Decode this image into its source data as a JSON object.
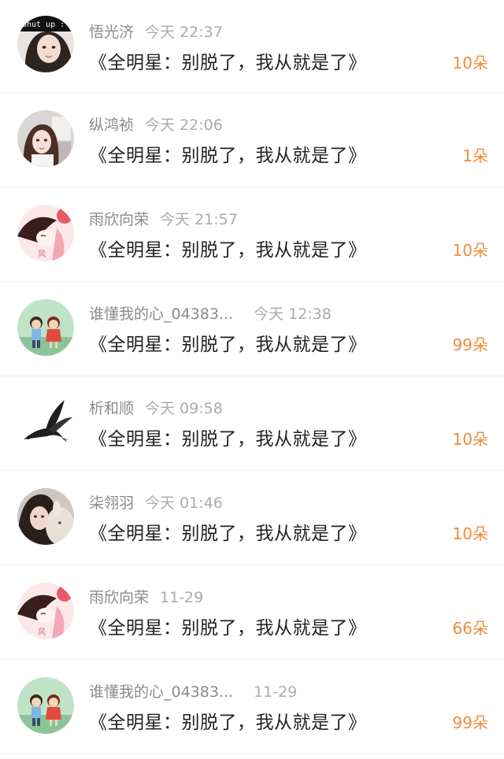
{
  "comments": [
    {
      "name": "悟光济",
      "time": "今天 22:37",
      "text": "《全明星：别脱了，我从就是了》",
      "gift": "10朵",
      "avatar": {
        "icon": "avatar-girl-photo-icon",
        "overlay": "Shut up :"
      }
    },
    {
      "name": "纵鸿祯",
      "time": "今天 22:06",
      "text": "《全明星：别脱了，我从就是了》",
      "gift": "1朵",
      "avatar": {
        "icon": "avatar-girl-room-icon"
      }
    },
    {
      "name": "雨欣向荣",
      "time": "今天 21:57",
      "text": "《全明星：别脱了，我从就是了》",
      "gift": "10朵",
      "avatar": {
        "icon": "avatar-anime-girl-icon"
      }
    },
    {
      "name": "谁懂我的心_04383...",
      "time": "今天 12:38",
      "text": "《全明星：别脱了，我从就是了》",
      "gift": "99朵",
      "avatar": {
        "icon": "avatar-cartoon-kids-icon"
      }
    },
    {
      "name": "析和顺",
      "time": "今天 09:58",
      "text": "《全明星：别脱了，我从就是了》",
      "gift": "10朵",
      "avatar": {
        "icon": "avatar-swallow-bird-icon"
      }
    },
    {
      "name": "柒翎羽",
      "time": "今天 01:46",
      "text": "《全明星：别脱了，我从就是了》",
      "gift": "10朵",
      "avatar": {
        "icon": "avatar-girl-plush-icon"
      }
    },
    {
      "name": "雨欣向荣",
      "time": "11-29",
      "text": "《全明星：别脱了，我从就是了》",
      "gift": "66朵",
      "avatar": {
        "icon": "avatar-anime-girl-icon"
      }
    },
    {
      "name": "谁懂我的心_04383...",
      "time": "11-29",
      "text": "《全明星：别脱了，我从就是了》",
      "gift": "99朵",
      "avatar": {
        "icon": "avatar-cartoon-kids-icon"
      }
    }
  ],
  "colors": {
    "gift": "#f08b3c",
    "name": "#8a8a8a",
    "time": "#ababab",
    "content": "#222222"
  }
}
